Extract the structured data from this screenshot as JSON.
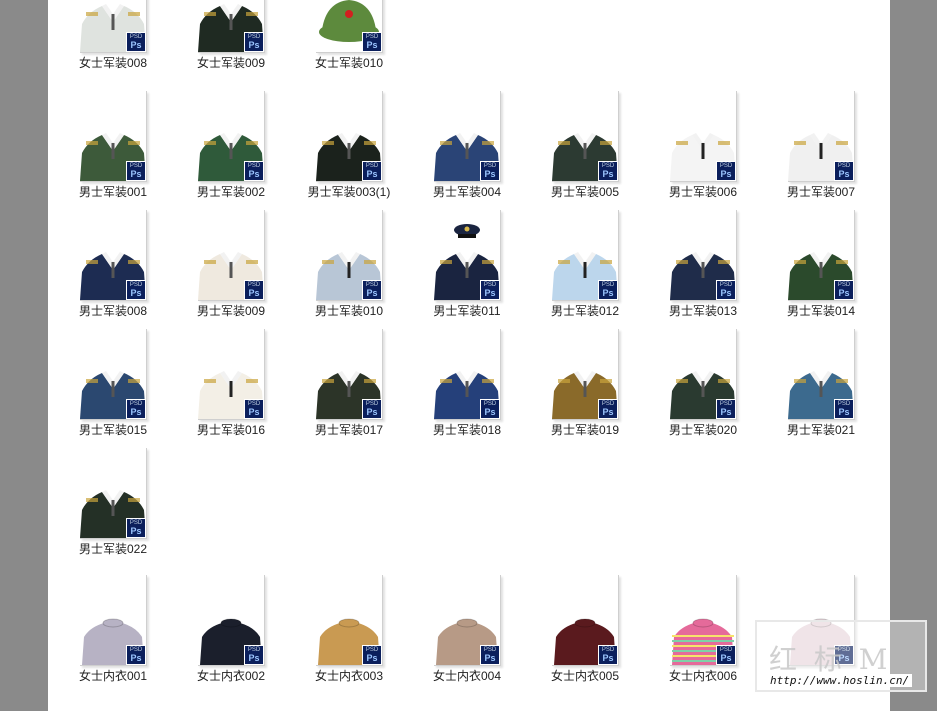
{
  "colors": {
    "background": "#8a8a8a",
    "pane": "#ffffff",
    "ps_badge": "#0b1f5c"
  },
  "badge": {
    "text": "Ps",
    "subtext": "PSD"
  },
  "items": [
    {
      "label": "女士军装008",
      "kind": "uniform",
      "color": "#dfe3df"
    },
    {
      "label": "女士军装009",
      "kind": "uniform",
      "color": "#1f2a22"
    },
    {
      "label": "女士军装010",
      "kind": "cap",
      "color": "#5d8a3d"
    },
    {
      "label": "男士军装001",
      "kind": "uniform",
      "color": "#3d5a3a"
    },
    {
      "label": "男士军装002",
      "kind": "uniform",
      "color": "#2f5a3a"
    },
    {
      "label": "男士军装003(1)",
      "kind": "uniform",
      "color": "#1b221c"
    },
    {
      "label": "男士军装004",
      "kind": "uniform",
      "color": "#2a4476"
    },
    {
      "label": "男士军装005",
      "kind": "uniform",
      "color": "#2c3a32"
    },
    {
      "label": "男士军装006",
      "kind": "shirt",
      "color": "#f4f4f4"
    },
    {
      "label": "男士军装007",
      "kind": "shirt",
      "color": "#f0f0f0"
    },
    {
      "label": "男士军装008",
      "kind": "uniform",
      "color": "#1d2c52"
    },
    {
      "label": "男士军装009",
      "kind": "uniform",
      "color": "#efe9df"
    },
    {
      "label": "男士军装010",
      "kind": "shirt",
      "color": "#b8c6d6"
    },
    {
      "label": "男士军装011",
      "kind": "capuniform",
      "color": "#1a2440"
    },
    {
      "label": "男士军装012",
      "kind": "shirt",
      "color": "#bcd6ec"
    },
    {
      "label": "男士军装013",
      "kind": "uniform",
      "color": "#1f2c4a"
    },
    {
      "label": "男士军装014",
      "kind": "uniform",
      "color": "#2b4a2c"
    },
    {
      "label": "男士军装015",
      "kind": "uniform",
      "color": "#2b4870"
    },
    {
      "label": "男士军装016",
      "kind": "shirt",
      "color": "#f3efe6"
    },
    {
      "label": "男士军装017",
      "kind": "uniform",
      "color": "#2c3428"
    },
    {
      "label": "男士军装018",
      "kind": "uniform",
      "color": "#25407a"
    },
    {
      "label": "男士军装019",
      "kind": "uniform",
      "color": "#8a6a2a"
    },
    {
      "label": "男士军装020",
      "kind": "uniform",
      "color": "#2a3a30"
    },
    {
      "label": "男士军装021",
      "kind": "uniform",
      "color": "#3c6a8e"
    },
    {
      "label": "男士军装022",
      "kind": "uniform",
      "color": "#243026"
    },
    {
      "label": "女士内衣001",
      "kind": "sweater",
      "color": "#b7b2c4"
    },
    {
      "label": "女士内衣002",
      "kind": "sweater",
      "color": "#1b1f2c"
    },
    {
      "label": "女士内衣003",
      "kind": "sweater",
      "color": "#c99a52"
    },
    {
      "label": "女士内衣004",
      "kind": "sweater",
      "color": "#b79a86"
    },
    {
      "label": "女士内衣005",
      "kind": "sweater",
      "color": "#5a1a1e"
    },
    {
      "label": "女士内衣006",
      "kind": "stripes",
      "color": "#e56a9a"
    },
    {
      "label": "",
      "kind": "sweater",
      "color": "#e8d6dc"
    }
  ],
  "watermark": {
    "logo": "红 标 M",
    "url": "http://www.hoslin.cn/"
  }
}
